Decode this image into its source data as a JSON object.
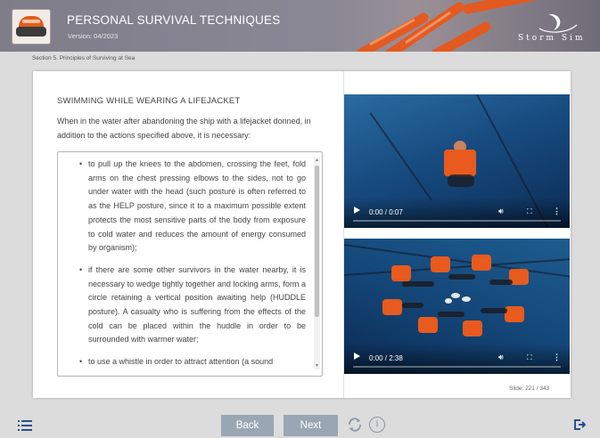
{
  "header": {
    "title": "PERSONAL SURVIVAL TECHNIQUES",
    "version": "Version: 04/2023",
    "brand": "Storm Sim"
  },
  "breadcrumb": "Section 5. Principles of Surviving at Sea",
  "content": {
    "heading": "SWIMMING WHILE WEARING A LIFEJACKET",
    "intro": "When in the water after abandoning the ship with a lifejacket donned, in addition to the actions specified above, it is necessary:",
    "bullets": [
      "to pull up the knees to the abdomen, crossing the feet, fold arms on the chest pressing elbows to the sides, not to go under water with the head (such posture is often referred to as the HELP posture, since it to a maximum possible extent protects the most sensitive parts of the body from exposure to cold water and reduces the amount of energy consumed by organism);",
      "if there are some other survivors in the water nearby, it is necessary to wedge tightly together and locking arms, form a circle retaining a vertical position awaiting help (HUDDLE posture). A casualty who is suffering from the effects of the cold can be placed within the huddle in order to be surrounded with warmer water;",
      "to use a whistle in order to attract attention (a sound"
    ]
  },
  "videos": [
    {
      "time": "0:00 / 0:07",
      "progress": 0.0
    },
    {
      "time": "0:00 / 2:38",
      "progress": 0.0
    }
  ],
  "slide_counter": "Slide: 221 / 343",
  "footer": {
    "back_label": "Back",
    "next_label": "Next",
    "info_glyph": "i"
  },
  "colors": {
    "header_bg": "#85838f",
    "button_bg": "#9aa6b4",
    "accent_orange": "#e85a1d",
    "icon_blue": "#2d4f8a"
  },
  "icons": [
    "menu-icon",
    "reload-icon",
    "info-icon",
    "exit-icon",
    "play-icon",
    "volume-icon",
    "fullscreen-icon",
    "more-icon"
  ]
}
